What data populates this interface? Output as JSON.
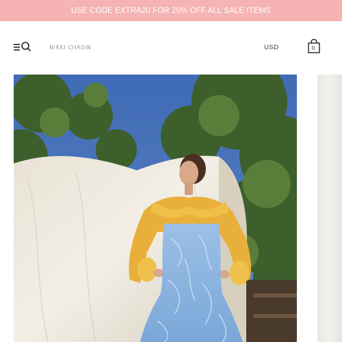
{
  "promo": {
    "text": "USE CODE EXTRA20 FOR 20% OFF ALL SALE ITEMS",
    "background": "#f5b3b3"
  },
  "header": {
    "brand": "NIKKI CHASIN",
    "currency": "USD",
    "cart_count": "0",
    "icons": [
      "menu-icon",
      "search-icon",
      "shopping-bag-icon"
    ]
  },
  "hero": {
    "alt": "Model wearing a yellow ruffle-collar blouse under a blue printed pinafore dress, standing in front of a white sheet and trees"
  }
}
